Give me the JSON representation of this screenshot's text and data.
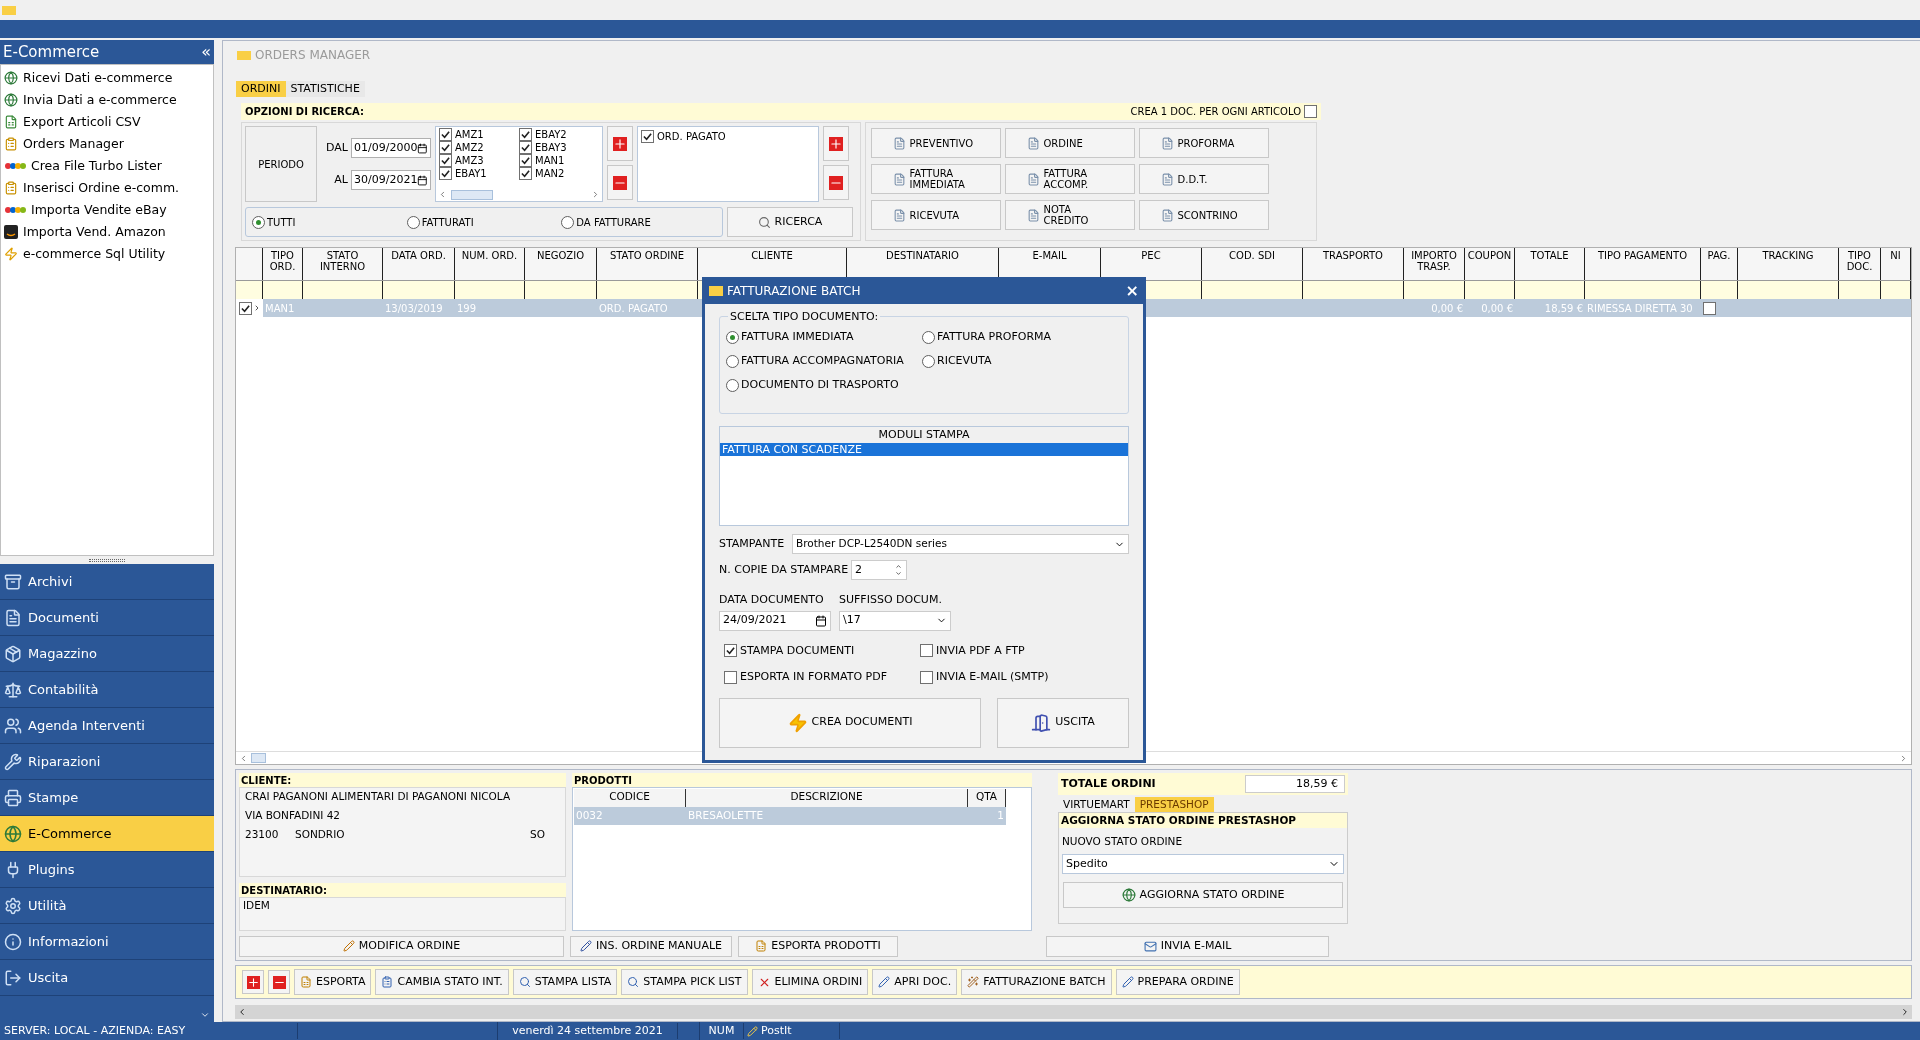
{
  "orders_window": {
    "title": "ORDERS MANAGER",
    "tabs": [
      {
        "label": "ORDINI",
        "selected": true
      },
      {
        "label": "STATISTICHE",
        "selected": false
      }
    ],
    "search": {
      "title": "OPZIONI DI RICERCA:",
      "per_article": {
        "label": "CREA 1 DOC. PER OGNI ARTICOLO",
        "checked": false
      },
      "period_label": "PERIODO",
      "from_label": "DAL",
      "from": "01/09/2000",
      "to_label": "AL",
      "to": "30/09/2021",
      "shops": [
        {
          "label": "AMZ1",
          "checked": true
        },
        {
          "label": "AMZ2",
          "checked": true
        },
        {
          "label": "AMZ3",
          "checked": true
        },
        {
          "label": "EBAY1",
          "checked": true
        },
        {
          "label": "EBAY2",
          "checked": true
        },
        {
          "label": "EBAY3",
          "checked": true
        },
        {
          "label": "MAN1",
          "checked": true
        },
        {
          "label": "MAN2",
          "checked": true
        }
      ],
      "statuses": [
        {
          "label": "ORD. PAGATO",
          "checked": true
        }
      ],
      "filters": [
        {
          "label": "TUTTI",
          "selected": true
        },
        {
          "label": "FATTURATI",
          "selected": false
        },
        {
          "label": "DA FATTURARE",
          "selected": false
        }
      ],
      "search_button": "RICERCA",
      "doc_buttons": [
        "PREVENTIVO",
        "ORDINE",
        "PROFORMA",
        "FATTURA IMMEDIATA",
        "FATTURA ACCOMP.",
        "D.D.T.",
        "RICEVUTA",
        "NOTA CREDITO",
        "SCONTRINO"
      ]
    },
    "table": {
      "columns": [
        {
          "label": "TIPO ORD.",
          "kind": "text"
        },
        {
          "label": "STATO INTERNO",
          "kind": "text"
        },
        {
          "label": "DATA ORD.",
          "kind": "text"
        },
        {
          "label": "NUM. ORD.",
          "kind": "text"
        },
        {
          "label": "NEGOZIO",
          "kind": "text"
        },
        {
          "label": "STATO ORDINE",
          "kind": "text"
        },
        {
          "label": "CLIENTE",
          "kind": "text"
        },
        {
          "label": "DESTINATARIO",
          "kind": "text"
        },
        {
          "label": "E-MAIL",
          "kind": "text"
        },
        {
          "label": "PEC",
          "kind": "text"
        },
        {
          "label": "COD. SDI",
          "kind": "text"
        },
        {
          "label": "TRASPORTO",
          "kind": "text"
        },
        {
          "label": "IMPORTO TRASP.",
          "kind": "text"
        },
        {
          "label": "COUPON",
          "kind": "text"
        },
        {
          "label": "TOTALE",
          "kind": "text"
        },
        {
          "label": "TIPO PAGAMENTO",
          "kind": "text"
        },
        {
          "label": "PAG.",
          "kind": "check"
        },
        {
          "label": "TRACKING",
          "kind": "text"
        },
        {
          "label": "TIPO DOC.",
          "kind": "text"
        },
        {
          "label": "NI",
          "kind": "text"
        }
      ],
      "rows": [
        {
          "selected": true,
          "checked": true,
          "paid": false,
          "cells": [
            "MAN1",
            null,
            "13/03/2019",
            "199",
            null,
            "ORD. PAGATO",
            null,
            null,
            null,
            null,
            null,
            null,
            "0,00 €",
            "0,00 €",
            "18,59 €",
            "RIMESSA DIRETTA 30",
            null,
            null,
            null,
            null
          ]
        }
      ]
    },
    "client": {
      "title": "CLIENTE:",
      "name": "CRAI PAGANONI ALIMENTARI DI PAGANONI NICOLA",
      "address": "VIA BONFADINI 42",
      "zip": "23100",
      "city": "SONDRIO",
      "province": "SO"
    },
    "recipient": {
      "title": "DESTINATARIO:",
      "text": "IDEM"
    },
    "products": {
      "title": "PRODOTTI",
      "columns": [
        "CODICE",
        "DESCRIZIONE",
        "QTA"
      ],
      "rows": [
        {
          "selected": true,
          "cells": [
            "0032",
            "BRESAOLETTE",
            "1"
          ]
        }
      ]
    },
    "totals": {
      "label": "TOTALE ORDINI",
      "value": "18,59 €"
    },
    "shop_tabs": [
      {
        "label": "VIRTUEMART",
        "selected": false
      },
      {
        "label": "PRESTASHOP",
        "selected": true
      }
    ],
    "update": {
      "title": "AGGIORNA STATO ORDINE PRESTASHOP",
      "field_label": "NUOVO STATO ORDINE",
      "value": "Spedito",
      "button": "AGGIORNA STATO ORDINE"
    },
    "actions": {
      "edit": "MODIFICA ORDINE",
      "manual": "INS. ORDINE MANUALE",
      "export_products": "ESPORTA PRODOTTI",
      "email": "INVIA E-MAIL"
    },
    "toolbar": [
      "ESPORTA",
      "CAMBIA STATO INT.",
      "STAMPA LISTA",
      "STAMPA PICK LIST",
      "ELIMINA ORDINI",
      "APRI DOC.",
      "FATTURAZIONE BATCH",
      "PREPARA ORDINE"
    ]
  },
  "sidebar": {
    "title": "E-Commerce",
    "collapse": "«",
    "items": [
      "Ricevi Dati e-commerce",
      "Invia Dati a e-commerce",
      "Export Articoli CSV",
      "Orders Manager",
      "Crea File Turbo Lister",
      "Inserisci Ordine e-comm.",
      "Importa Vendite eBay",
      "Importa Vend. Amazon",
      "e-commerce Sql Utility"
    ],
    "nav": [
      {
        "label": "Archivi",
        "selected": false
      },
      {
        "label": "Documenti",
        "selected": false
      },
      {
        "label": "Magazzino",
        "selected": false
      },
      {
        "label": "Contabilità",
        "selected": false
      },
      {
        "label": "Agenda Interventi",
        "selected": false
      },
      {
        "label": "Riparazioni",
        "selected": false
      },
      {
        "label": "Stampe",
        "selected": false
      },
      {
        "label": "E-Commerce",
        "selected": true
      },
      {
        "label": "Plugins",
        "selected": false
      },
      {
        "label": "Utilità",
        "selected": false
      },
      {
        "label": "Informazioni",
        "selected": false
      },
      {
        "label": "Uscita",
        "selected": false
      }
    ]
  },
  "dialog": {
    "title": "FATTURAZIONE BATCH",
    "close": "×",
    "group_title": "SCELTA TIPO DOCUMENTO:",
    "doc_types": [
      {
        "label": "FATTURA IMMEDIATA",
        "selected": true
      },
      {
        "label": "FATTURA PROFORMA",
        "selected": false
      },
      {
        "label": "FATTURA ACCOMPAGNATORIA",
        "selected": false
      },
      {
        "label": "RICEVUTA",
        "selected": false
      },
      {
        "label": "DOCUMENTO DI TRASPORTO",
        "selected": false
      }
    ],
    "modules_title": "MODULI STAMPA",
    "modules": [
      {
        "label": "FATTURA CON SCADENZE",
        "selected": true
      }
    ],
    "printer_label": "STAMPANTE",
    "printer": "Brother DCP-L2540DN series",
    "copies_label": "N. COPIE DA STAMPARE",
    "copies": "2",
    "date_label": "DATA DOCUMENTO",
    "date": "24/09/2021",
    "suffix_label": "SUFFISSO DOCUM.",
    "suffix": "\\17",
    "options": [
      {
        "label": "STAMPA DOCUMENTI",
        "checked": true
      },
      {
        "label": "INVIA PDF A FTP",
        "checked": false
      },
      {
        "label": "ESPORTA IN FORMATO PDF",
        "checked": false
      },
      {
        "label": "INVIA E-MAIL (SMTP)",
        "checked": false
      }
    ],
    "create_button": "CREA DOCUMENTI",
    "exit_button": "USCITA"
  },
  "status_bar": [
    "SERVER: LOCAL - AZIENDA: EASY",
    "venerdì 24 settembre 2021",
    "NUM",
    "PostIt"
  ]
}
